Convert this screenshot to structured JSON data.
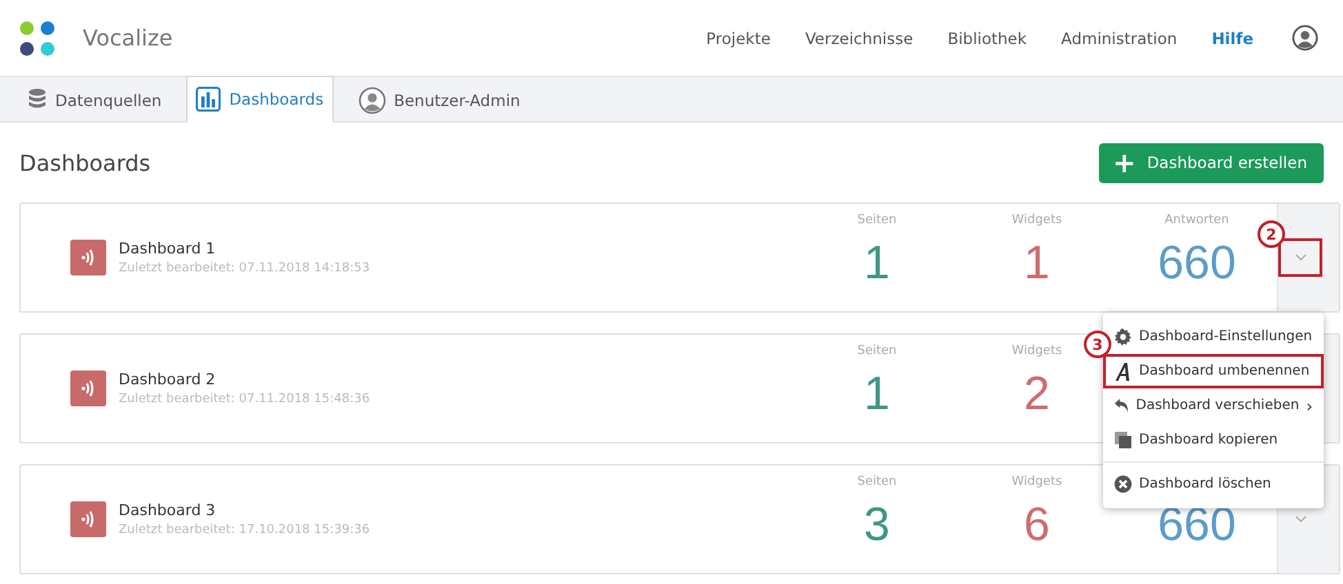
{
  "brand": {
    "name": "Vocalize"
  },
  "nav": [
    {
      "label": "Projekte",
      "selected": false
    },
    {
      "label": "Verzeichnisse",
      "selected": false
    },
    {
      "label": "Bibliothek",
      "selected": false
    },
    {
      "label": "Administration",
      "selected": false
    },
    {
      "label": "Hilfe",
      "selected": true
    }
  ],
  "tabs": [
    {
      "label": "Datenquellen",
      "kind": "database",
      "selected": false
    },
    {
      "label": "Dashboards",
      "kind": "chart",
      "selected": true
    },
    {
      "label": "Benutzer-Admin",
      "kind": "user",
      "selected": false
    }
  ],
  "page_title": "Dashboards",
  "create_button": {
    "icon": "+",
    "label": "Dashboard erstellen"
  },
  "dashboards": [
    {
      "name": "Dashboard 1",
      "edited": "Zuletzt bearbeitet: 07.11.2018 14:18:53",
      "stats": [
        {
          "label": "Seiten",
          "value": "1",
          "kind": "pages"
        },
        {
          "label": "Widgets",
          "value": "1",
          "kind": "widgets"
        },
        {
          "label": "Antworten",
          "value": "660",
          "kind": "answers"
        }
      ],
      "menu_toggle": true,
      "callout": "2"
    },
    {
      "name": "Dashboard 2",
      "edited": "Zuletzt bearbeitet: 07.11.2018 15:48:36",
      "stats": [
        {
          "label": "Seiten",
          "value": "1",
          "kind": "pages"
        },
        {
          "label": "Widgets",
          "value": "2",
          "kind": "widgets"
        }
      ]
    },
    {
      "name": "Dashboard 3",
      "edited": "Zuletzt bearbeitet: 17.10.2018 15:39:36",
      "stats": [
        {
          "label": "Seiten",
          "value": "3",
          "kind": "pages"
        },
        {
          "label": "Widgets",
          "value": "6",
          "kind": "widgets"
        },
        {
          "value": "660",
          "kind": "answers"
        }
      ],
      "menu_toggle": true
    }
  ],
  "menu": [
    {
      "label": "Dashboard-Einstellungen",
      "kind": "settings",
      "selected": false
    },
    {
      "label": "Dashboard umbenennen",
      "kind": "rename",
      "selected": true,
      "callout": "3"
    },
    {
      "label": "Dashboard verschieben",
      "kind": "move",
      "selected": false,
      "arrow": "›"
    },
    {
      "label": "Dashboard kopieren",
      "kind": "copy",
      "selected": false
    },
    {
      "label": "Dashboard löschen",
      "kind": "delete",
      "selected": false,
      "divider_before": true
    }
  ]
}
